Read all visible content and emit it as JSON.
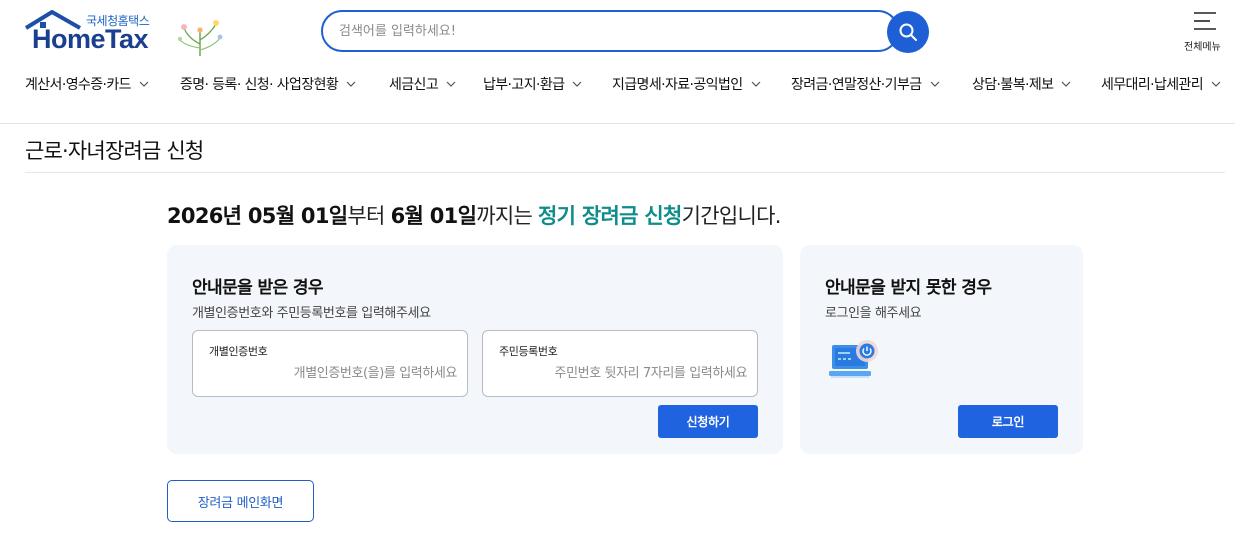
{
  "header": {
    "logo_sub": "국세청홈택스",
    "logo_main": "HomeTax",
    "search_placeholder": "검색어를 입력하세요!",
    "allmenu_label": "전체메뉴"
  },
  "gnb": {
    "items": [
      "계산서·영수증·카드",
      "증명· 등록· 신청· 사업장현황",
      "세금신고",
      "납부·고지·환급",
      "지급명세·자료·공익법인",
      "장려금·연말정산·기부금",
      "상담·불복·제보",
      "세무대리·납세관리"
    ]
  },
  "page": {
    "title": "근로·자녀장려금 신청",
    "period": {
      "start_date": "2026년 05월 01일",
      "text_from": "부터 ",
      "end_date": "6월 01일",
      "text_until": "까지는 ",
      "highlight": "정기 장려금 신청",
      "text_end": "기간입니다."
    }
  },
  "panel_notice": {
    "title": "안내문을 받은 경우",
    "desc": "개별인증번호와 주민등록번호를 입력해주세요",
    "field1_label": "개별인증번호",
    "field1_placeholder": "개별인증번호(을)를 입력하세요",
    "field2_label": "주민등록번호",
    "field2_placeholder": "주민번호 뒷자리 7자리를 입력하세요",
    "submit_label": "신청하기"
  },
  "panel_login": {
    "title": "안내문을 받지 못한 경우",
    "desc": "로그인을 해주세요",
    "login_label": "로그인"
  },
  "footer": {
    "main_button": "장려금 메인화면"
  },
  "colors": {
    "brand_blue": "#1f63e0",
    "highlight_teal": "#0f8d8a",
    "panel_bg": "#f3f6fa"
  }
}
